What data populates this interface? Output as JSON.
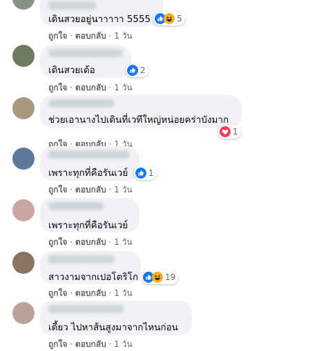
{
  "colors": {
    "like": "#1877f2",
    "haha": "#f7b125",
    "love": "#f33e58",
    "bubble": "#f0f2f5",
    "meta_text": "#65676b"
  },
  "actions": {
    "like": "ถูกใจ",
    "reply": "ตอบกลับ",
    "separator": "·",
    "time": "1 วัน"
  },
  "comments": [
    {
      "text": "เดินสวยอยู่นาาาาา 5555",
      "reactions": [
        "like-icon",
        "haha-icon"
      ],
      "count": "5"
    },
    {
      "text": "เดินสวยเด้อ",
      "reactions": [
        "like-icon"
      ],
      "count": "2"
    },
    {
      "text": "ช่วยเอานางไปเดินที่เวทีใหญ่หน่อยคร่าบังมาก",
      "reactions": [
        "love-icon"
      ],
      "count": "1"
    },
    {
      "text": "เพราะทุกที่คือรันเวย์",
      "reactions": [
        "like-icon"
      ],
      "count": "1"
    },
    {
      "text": "เพราะทุกที่คือรันเวย์",
      "reactions": [],
      "count": ""
    },
    {
      "text": "สาวงามจากเปอโตริโก",
      "reactions": [
        "like-icon",
        "haha-icon"
      ],
      "count": "19"
    },
    {
      "text": "เตี้ยว ไปหาส้นสูงมาจากไหนก่อน",
      "reactions": [],
      "count": ""
    }
  ]
}
